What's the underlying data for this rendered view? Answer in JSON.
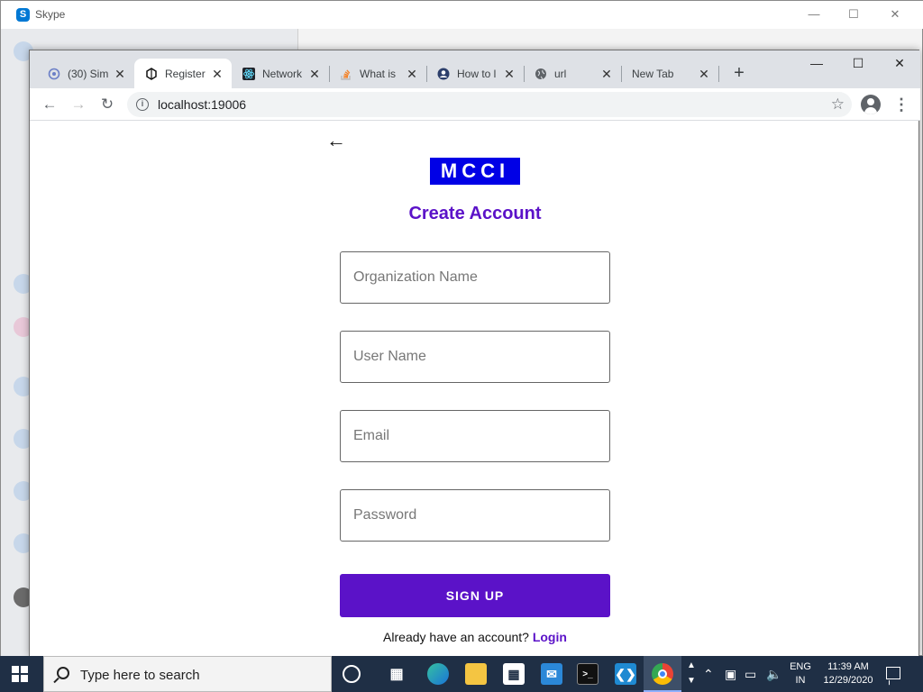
{
  "skype": {
    "title": "Skype"
  },
  "browser": {
    "tabs": [
      {
        "title": "(30) Sim",
        "icon": "openai-icon"
      },
      {
        "title": "Register",
        "icon": "expo-icon"
      },
      {
        "title": "Network",
        "icon": "react-icon"
      },
      {
        "title": "What is",
        "icon": "stackoverflow-icon"
      },
      {
        "title": "How to l",
        "icon": "user-circle-icon"
      },
      {
        "title": "url",
        "icon": "globe-icon"
      },
      {
        "title": "New Tab",
        "icon": ""
      }
    ],
    "active_tab_index": 1,
    "url": "localhost:19006"
  },
  "page": {
    "logo_text": "MCCI",
    "heading": "Create Account",
    "fields": {
      "organization_placeholder": "Organization Name",
      "username_placeholder": "User Name",
      "email_placeholder": "Email",
      "password_placeholder": "Password"
    },
    "signup_label": "SIGN UP",
    "already_text": "Already have an account?",
    "login_link": "Login"
  },
  "taskbar": {
    "search_placeholder": "Type here to search",
    "lang_line1": "ENG",
    "lang_line2": "IN",
    "time": "11:39 AM",
    "date": "12/29/2020"
  },
  "colors": {
    "accent": "#5b12c8",
    "logo_bg": "#0000e6",
    "taskbar": "#1f2f45"
  }
}
